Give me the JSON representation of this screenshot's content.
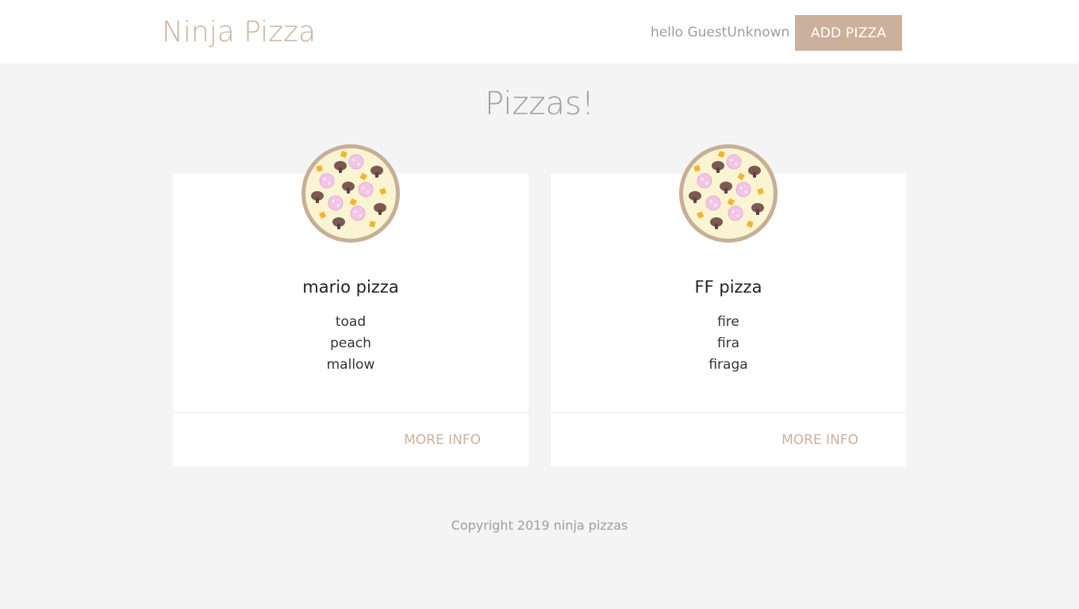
{
  "navbar": {
    "brand": "Ninja Pizza",
    "greeting": "hello GuestUnknown",
    "add_button_label": "ADD PIZZA"
  },
  "main": {
    "title": "Pizzas!",
    "pizzas": [
      {
        "name": "mario pizza",
        "ingredients": [
          "toad",
          "peach",
          "mallow"
        ],
        "action_label": "MORE INFO"
      },
      {
        "name": "FF pizza",
        "ingredients": [
          "fire",
          "fira",
          "firaga"
        ],
        "action_label": "MORE INFO"
      }
    ]
  },
  "footer": {
    "copyright": "Copyright 2019 ninja pizzas"
  },
  "colors": {
    "brand": "#cbb09c",
    "background": "#f4f4f4",
    "card": "#ffffff",
    "muted_text": "#9e9e9e"
  },
  "icons": {
    "pizza": "pizza-icon"
  }
}
